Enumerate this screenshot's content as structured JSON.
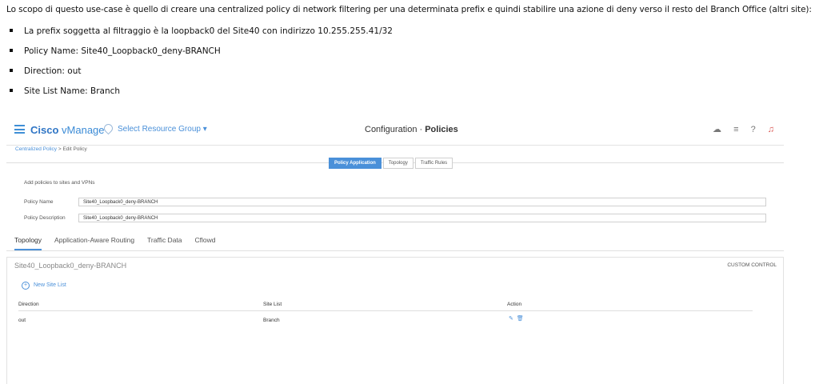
{
  "document": {
    "intro": "Lo scopo di questo use-case è quello di creare una centralized policy di network filtering per una determinata prefix e quindi stabilire una azione di deny verso il resto del Branch Office (altri site):",
    "bullets": [
      "La prefix soggetta al filtraggio è la loopback0 del Site40 con indirizzo 10.255.255.41/32",
      "Policy Name: Site40_Loopback0_deny-BRANCH",
      "Direction: out",
      "Site List Name: Branch"
    ]
  },
  "header": {
    "brand": "Cisco",
    "brand_sub": "vManage",
    "resource_group": "Select Resource Group",
    "title_prefix": "Configuration · ",
    "title_bold": "Policies"
  },
  "breadcrumb": {
    "parent": "Centralized Policy",
    "separator": ">",
    "current": "Edit Policy"
  },
  "segment_tabs": [
    "Policy Application",
    "Topology",
    "Traffic Rules"
  ],
  "form": {
    "section": "Add policies to sites and VPNs",
    "policy_name_label": "Policy Name",
    "policy_name_value": "Site40_Loopback0_deny-BRANCH",
    "policy_desc_label": "Policy Description",
    "policy_desc_value": "Site40_Loopback0_deny-BRANCH"
  },
  "tabs": [
    "Topology",
    "Application-Aware Routing",
    "Traffic Data",
    "Cflowd"
  ],
  "panel": {
    "title": "Site40_Loopback0_deny-BRANCH",
    "custom_control": "CUSTOM CONTROL",
    "new_site_list": "New Site List",
    "columns": [
      "Direction",
      "Site List",
      "Action"
    ],
    "rows": [
      {
        "direction": "out",
        "site_list": "Branch"
      }
    ]
  },
  "colors": {
    "accent": "#4a90d9",
    "brand": "#2f75c5",
    "alert": "#d9534f"
  }
}
